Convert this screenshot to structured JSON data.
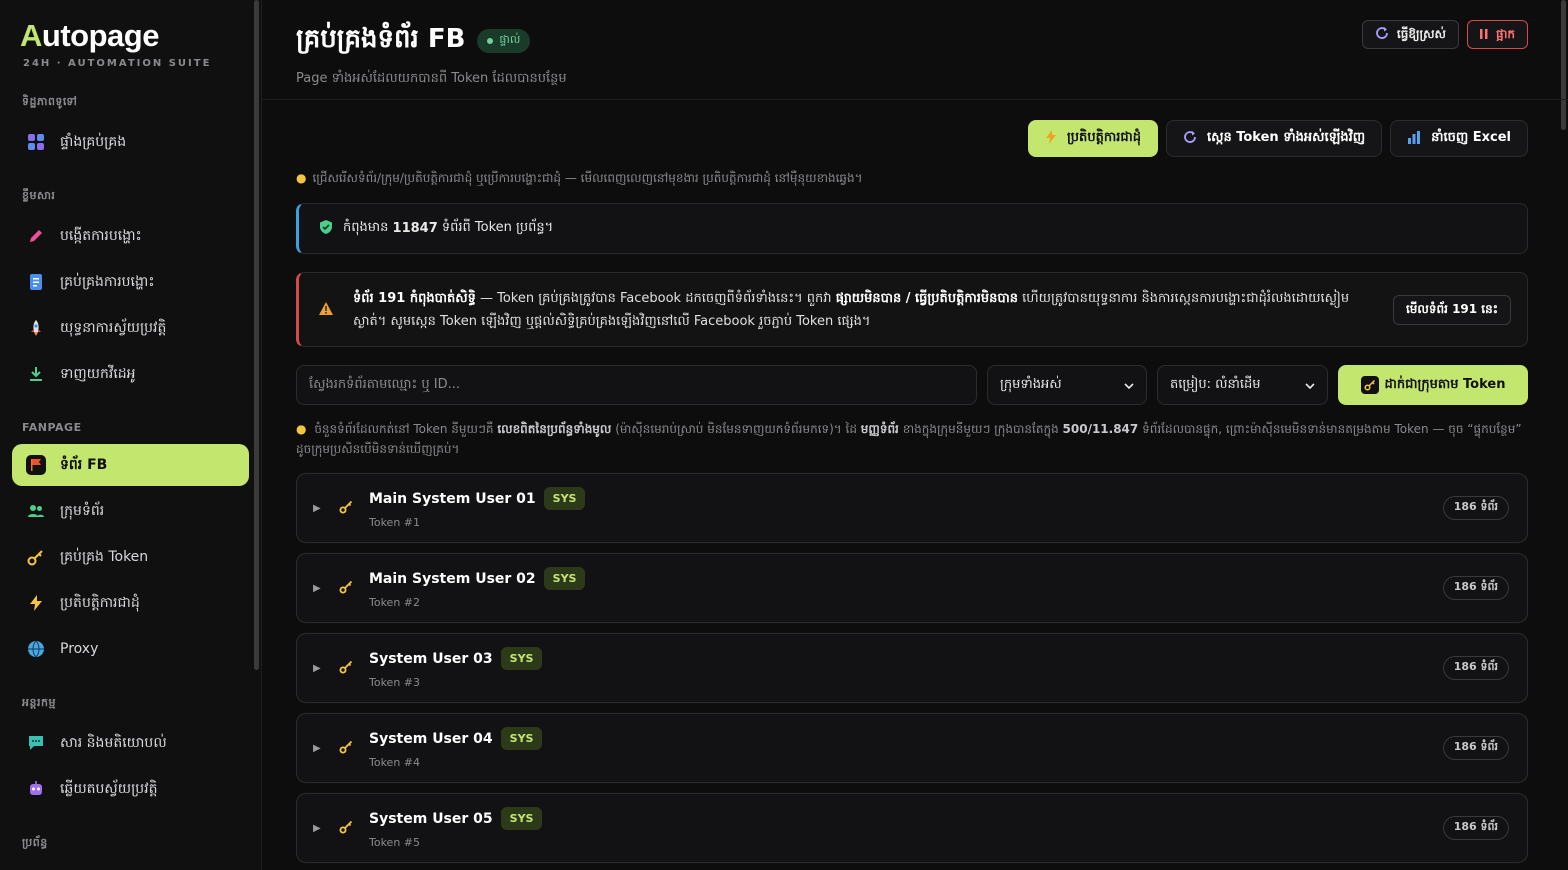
{
  "brand": {
    "logo_first": "A",
    "logo_rest": "utopage",
    "tagline": "24H · AUTOMATION SUITE"
  },
  "sidebar": {
    "sections": [
      {
        "title": "ទិដ្ឋភាពទូទៅ",
        "items": [
          {
            "label": "ផ្ទាំងគ្រប់គ្រង",
            "icon": "grid-icon"
          }
        ]
      },
      {
        "title": "ខ្លឹមសារ",
        "items": [
          {
            "label": "បង្កើតការបង្ហោះ",
            "icon": "pencil-icon"
          },
          {
            "label": "គ្រប់គ្រងការបង្ហោះ",
            "icon": "document-icon"
          },
          {
            "label": "យុទ្ធនាការស្វ័យប្រវត្តិ",
            "icon": "rocket-icon"
          },
          {
            "label": "ទាញយកវីដេអូ",
            "icon": "download-icon"
          }
        ]
      },
      {
        "title": "FANPAGE",
        "items": [
          {
            "label": "ទំព័រ FB",
            "icon": "flag-icon",
            "active": true
          },
          {
            "label": "ក្រុមទំព័រ",
            "icon": "users-icon"
          },
          {
            "label": "គ្រប់គ្រង Token",
            "icon": "key-icon"
          },
          {
            "label": "ប្រតិបត្តិការជាដុំ",
            "icon": "bolt-icon"
          },
          {
            "label": "Proxy",
            "icon": "globe-icon"
          }
        ]
      },
      {
        "title": "អន្តរកម្ម",
        "items": [
          {
            "label": "សារ និងមតិយោបល់",
            "icon": "chat-icon"
          },
          {
            "label": "ឆ្លើយតបស្វ័យប្រវត្តិ",
            "icon": "robot-icon"
          }
        ]
      },
      {
        "title": "ប្រព័ន្ធ",
        "items": []
      }
    ]
  },
  "header": {
    "title": "គ្រប់គ្រងទំព័រ FB",
    "live_badge": "ផ្ទាល់",
    "subtitle": "Page ទាំងអស់ដែលយកបានពី Token ដែលបានបន្ថែម",
    "refresh_label": "ធ្វើឱ្យស្រស់",
    "stop_label": "ផ្អាក"
  },
  "actions": {
    "bulk_label": "ប្រតិបត្តិការជាដុំ",
    "rescan_label": "ស្កេន Token ទាំងអស់ឡើងវិញ",
    "export_label": "នាំចេញ Excel"
  },
  "hint_top": "ជ្រើសរើសទំព័រ/ក្រុម/ប្រតិបត្តិការជាដុំ ឬប្រើការបង្ហោះជាដុំ — មើលពេញលេញនៅមុខងារ ប្រតិបត្តិការជាដុំ នៅម៉ឺនុយខាងឆ្វេង។",
  "info": {
    "prefix": "កំពុងមាន",
    "count": "11847",
    "suffix": "ទំព័រពី Token ប្រព័ន្ធ។"
  },
  "warning": {
    "headline": "ទំព័រ 191 កំពុងបាត់សិទ្ធិ",
    "part1": "— Token គ្រប់គ្រងត្រូវបាន Facebook ដកចេញពីទំព័រទាំងនេះ។ ពួកវា",
    "strong": "ផ្សាយមិនបាន / ធ្វើប្រតិបត្តិការមិនបាន",
    "part2": "ហើយត្រូវបានយុទ្ធនាការ និងការស្កេនការបង្ហោះជាដុំរំលងដោយស្ងៀមស្ងាត់។ សូមស្កេន Token ឡើងវិញ ឬផ្តល់សិទ្ធិគ្រប់គ្រងឡើងវិញនៅលើ Facebook រួចភ្ជាប់ Token ផ្សេង។",
    "button": "មើលទំព័រ 191 នេះ"
  },
  "filters": {
    "search_placeholder": "ស្វែងរកទំព័រតាមឈ្មោះ ឬ ID...",
    "group_select": "ក្រុមទាំងអស់",
    "sort_select": "តម្រៀប: លំនាំដើម",
    "group_by_token": "ដាក់ជាក្រុមតាម Token"
  },
  "hint_groups": {
    "part1": "ចំនួនទំព័រដែលកត់នៅ Token នីមួយៗគឺ",
    "bold1": "លេខពិតនៃប្រព័ន្ធទាំងមូល",
    "part2": "(ម៉ាស៊ីនមេរាប់ស្រាប់ មិនមែនទាញយកទំព័រមកទេ)។ ដៃ",
    "bold2": "មញ្ញទំព័រ",
    "part3": "ខាងក្នុងក្រុមនីមួយៗ ក្រុងបានតែក្នុង",
    "bold3": "500/11.847",
    "part4": "ទំព័រដែលបានផ្ទុក, ព្រោះម៉ាស៊ីនមេមិនទាន់មានតម្រងតាម Token — ចុច “ផ្ទុកបន្ថែម” ដូចក្រុមប្រសិនបើមិនទាន់ឃើញគ្រប់។"
  },
  "tokens": [
    {
      "name": "Main System User 01",
      "badge": "SYS",
      "sub": "Token #1",
      "count": "186 ទំព័រ"
    },
    {
      "name": "Main System User 02",
      "badge": "SYS",
      "sub": "Token #2",
      "count": "186 ទំព័រ"
    },
    {
      "name": "System User 03",
      "badge": "SYS",
      "sub": "Token #3",
      "count": "186 ទំព័រ"
    },
    {
      "name": "System User 04",
      "badge": "SYS",
      "sub": "Token #4",
      "count": "186 ទំព័រ"
    },
    {
      "name": "System User 05",
      "badge": "SYS",
      "sub": "Token #5",
      "count": "186 ទំព័រ"
    }
  ],
  "colors": {
    "accent": "#c3e66e",
    "danger": "#d84a4a",
    "info": "#3aa0e0"
  }
}
